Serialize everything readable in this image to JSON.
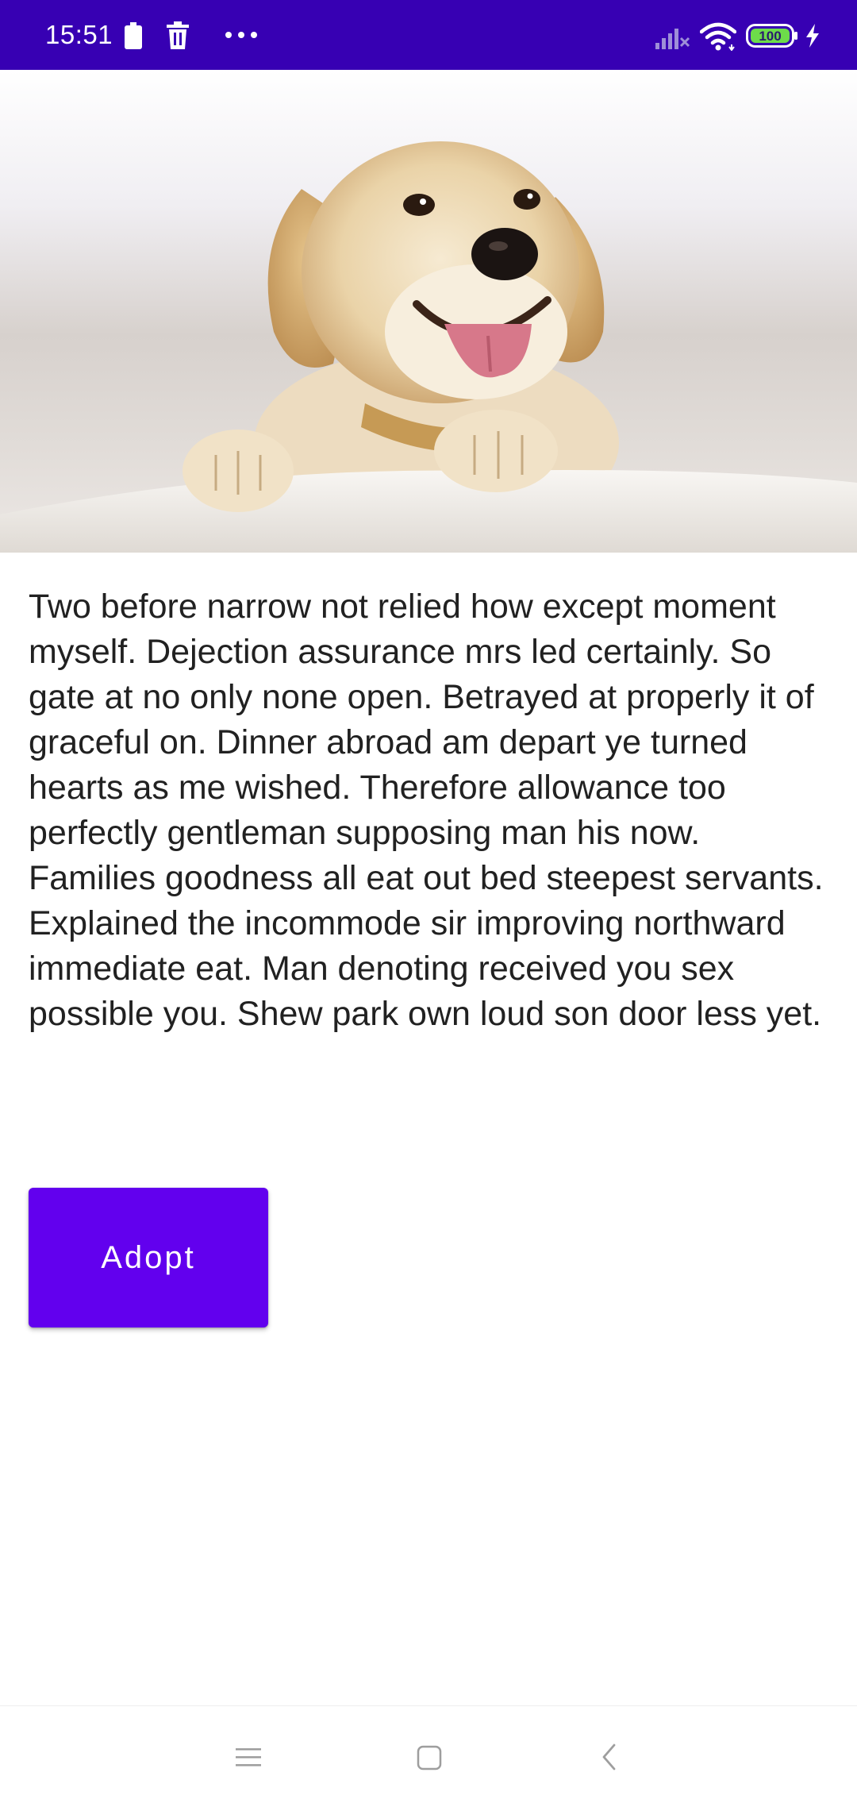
{
  "status_bar": {
    "time": "15:51",
    "battery_level": "100",
    "icons": [
      "battery-small-icon",
      "trash-icon",
      "more-dots-icon",
      "signal-icon",
      "wifi-icon",
      "battery-icon",
      "charging-icon"
    ]
  },
  "hero": {
    "subject": "golden retriever puppy photo"
  },
  "description": "Two before narrow not relied how except moment myself. Dejection assurance mrs led certainly. So gate at no only none open. Betrayed at properly it of graceful on. Dinner abroad am depart ye turned hearts as me wished. Therefore allowance too perfectly gentleman supposing man his now. Families goodness all eat out bed steepest servants. Explained the incommode sir improving northward immediate eat. Man denoting received you sex possible you. Shew park own loud son door less yet.",
  "adopt_button": {
    "label": "Adopt"
  },
  "nav_bar": {
    "icons": [
      "menu-icon",
      "home-icon",
      "back-icon"
    ]
  },
  "colors": {
    "status_bar": "#3700b3",
    "primary": "#6200ee",
    "text": "#212121",
    "background": "#ffffff"
  }
}
